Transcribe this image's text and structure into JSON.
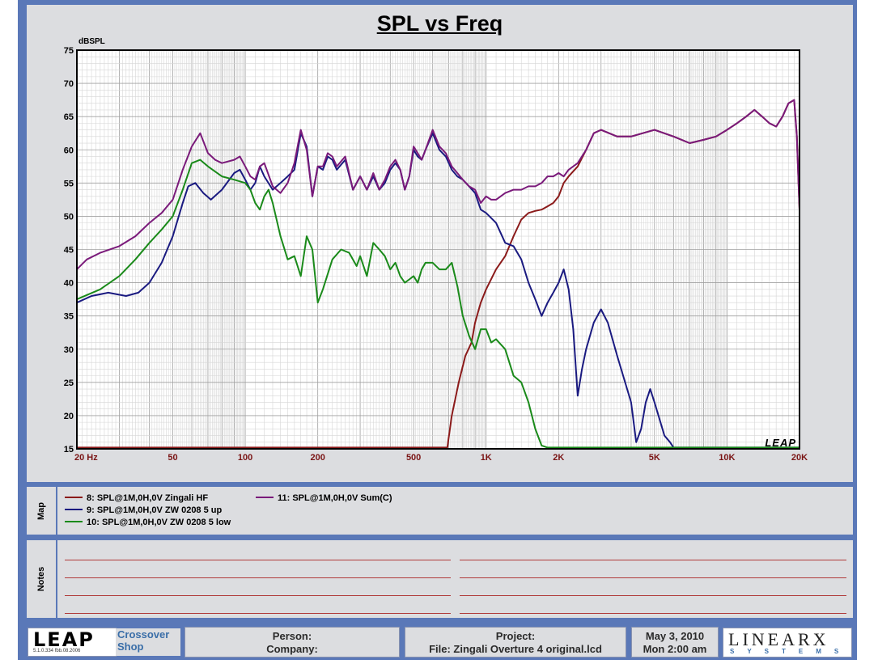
{
  "chart_data": {
    "type": "line",
    "title": "SPL vs Freq",
    "ylabel": "dBSPL",
    "xlabel": "",
    "xscale": "log",
    "xlim": [
      20,
      20000
    ],
    "ylim": [
      15,
      75
    ],
    "grid": true,
    "yticks": [
      "75",
      "70",
      "65",
      "60",
      "55",
      "50",
      "45",
      "40",
      "35",
      "30",
      "25",
      "20",
      "15"
    ],
    "xticks": [
      {
        "v": 20,
        "label": "20  Hz"
      },
      {
        "v": 50,
        "label": "50"
      },
      {
        "v": 100,
        "label": "100"
      },
      {
        "v": 200,
        "label": "200"
      },
      {
        "v": 500,
        "label": "500"
      },
      {
        "v": 1000,
        "label": "1K"
      },
      {
        "v": 2000,
        "label": "2K"
      },
      {
        "v": 5000,
        "label": "5K"
      },
      {
        "v": 10000,
        "label": "10K"
      },
      {
        "v": 20000,
        "label": "20K"
      }
    ],
    "series": [
      {
        "name": "8: SPL@1M,0H,0V Zingali HF",
        "color": "#8b1a1a",
        "points": [
          [
            20,
            15.2
          ],
          [
            600,
            15.2
          ],
          [
            690,
            15.2
          ],
          [
            720,
            20
          ],
          [
            770,
            25
          ],
          [
            820,
            29
          ],
          [
            870,
            31
          ],
          [
            900,
            34
          ],
          [
            950,
            37
          ],
          [
            1000,
            39
          ],
          [
            1100,
            42
          ],
          [
            1200,
            44
          ],
          [
            1300,
            47
          ],
          [
            1400,
            49.5
          ],
          [
            1500,
            50.5
          ],
          [
            1600,
            50.8
          ],
          [
            1700,
            51
          ],
          [
            1800,
            51.5
          ],
          [
            1900,
            52
          ],
          [
            2000,
            53
          ],
          [
            2100,
            55
          ],
          [
            2200,
            56
          ],
          [
            2400,
            57.5
          ],
          [
            2600,
            60
          ],
          [
            2800,
            62.5
          ],
          [
            3000,
            63
          ],
          [
            3500,
            62
          ],
          [
            4000,
            62
          ],
          [
            5000,
            63
          ],
          [
            6000,
            62
          ],
          [
            7000,
            61
          ],
          [
            8000,
            61.5
          ],
          [
            9000,
            62
          ],
          [
            10000,
            63
          ],
          [
            11000,
            64
          ],
          [
            12000,
            65
          ],
          [
            13000,
            66
          ],
          [
            14000,
            65
          ],
          [
            15000,
            64
          ],
          [
            16000,
            63.5
          ],
          [
            17000,
            65
          ],
          [
            18000,
            67
          ],
          [
            19000,
            67.5
          ],
          [
            19500,
            62
          ],
          [
            20000,
            51
          ]
        ]
      },
      {
        "name": "9: SPL@1M,0H,0V ZW 0208 5 up",
        "color": "#1a1a80",
        "points": [
          [
            20,
            37
          ],
          [
            23,
            38
          ],
          [
            27,
            38.5
          ],
          [
            32,
            38
          ],
          [
            36,
            38.5
          ],
          [
            40,
            40
          ],
          [
            45,
            43
          ],
          [
            50,
            47
          ],
          [
            55,
            52
          ],
          [
            58,
            54.5
          ],
          [
            62,
            55
          ],
          [
            67,
            53.5
          ],
          [
            72,
            52.5
          ],
          [
            80,
            54
          ],
          [
            90,
            56.5
          ],
          [
            95,
            57
          ],
          [
            100,
            55.5
          ],
          [
            105,
            54
          ],
          [
            110,
            55
          ],
          [
            115,
            57.5
          ],
          [
            120,
            56
          ],
          [
            130,
            54
          ],
          [
            140,
            55
          ],
          [
            150,
            56
          ],
          [
            160,
            57
          ],
          [
            170,
            62.5
          ],
          [
            180,
            60.5
          ],
          [
            190,
            53
          ],
          [
            200,
            57.5
          ],
          [
            210,
            57
          ],
          [
            220,
            59
          ],
          [
            230,
            58.5
          ],
          [
            240,
            57
          ],
          [
            260,
            58.5
          ],
          [
            280,
            54
          ],
          [
            300,
            56
          ],
          [
            320,
            54
          ],
          [
            340,
            56
          ],
          [
            360,
            54
          ],
          [
            380,
            55
          ],
          [
            400,
            57
          ],
          [
            420,
            58
          ],
          [
            440,
            57
          ],
          [
            460,
            54
          ],
          [
            480,
            56
          ],
          [
            500,
            60
          ],
          [
            520,
            59
          ],
          [
            540,
            58.5
          ],
          [
            560,
            60
          ],
          [
            600,
            62.5
          ],
          [
            640,
            60
          ],
          [
            680,
            59
          ],
          [
            720,
            57
          ],
          [
            760,
            56
          ],
          [
            800,
            55.5
          ],
          [
            850,
            54.5
          ],
          [
            900,
            53.5
          ],
          [
            950,
            51
          ],
          [
            1000,
            50.5
          ],
          [
            1100,
            49
          ],
          [
            1200,
            46
          ],
          [
            1300,
            45.5
          ],
          [
            1400,
            43.5
          ],
          [
            1500,
            40
          ],
          [
            1600,
            37.5
          ],
          [
            1700,
            35
          ],
          [
            1800,
            37
          ],
          [
            1900,
            38.5
          ],
          [
            2000,
            40
          ],
          [
            2100,
            42
          ],
          [
            2200,
            39
          ],
          [
            2300,
            33
          ],
          [
            2400,
            23
          ],
          [
            2500,
            27
          ],
          [
            2600,
            30
          ],
          [
            2800,
            34
          ],
          [
            3000,
            36
          ],
          [
            3200,
            34
          ],
          [
            3500,
            29
          ],
          [
            4000,
            22
          ],
          [
            4200,
            16
          ],
          [
            4400,
            18
          ],
          [
            4600,
            22
          ],
          [
            4800,
            24
          ],
          [
            5000,
            22
          ],
          [
            5500,
            17
          ],
          [
            5800,
            16
          ],
          [
            6000,
            15.2
          ],
          [
            20000,
            15.2
          ]
        ]
      },
      {
        "name": "10: SPL@1M,0H,0V ZW 0208 5 low",
        "color": "#1a8a1a",
        "points": [
          [
            20,
            37.5
          ],
          [
            25,
            39
          ],
          [
            30,
            41
          ],
          [
            35,
            43.5
          ],
          [
            40,
            46
          ],
          [
            45,
            48
          ],
          [
            50,
            50
          ],
          [
            55,
            54
          ],
          [
            60,
            58
          ],
          [
            65,
            58.5
          ],
          [
            70,
            57.5
          ],
          [
            80,
            56
          ],
          [
            90,
            55.5
          ],
          [
            100,
            55
          ],
          [
            105,
            54
          ],
          [
            110,
            52
          ],
          [
            115,
            51
          ],
          [
            120,
            53
          ],
          [
            125,
            54
          ],
          [
            130,
            52
          ],
          [
            140,
            47
          ],
          [
            150,
            43.5
          ],
          [
            160,
            44
          ],
          [
            170,
            41
          ],
          [
            180,
            47
          ],
          [
            190,
            45
          ],
          [
            200,
            37
          ],
          [
            210,
            39
          ],
          [
            230,
            43.5
          ],
          [
            250,
            45
          ],
          [
            270,
            44.5
          ],
          [
            290,
            42.5
          ],
          [
            300,
            44
          ],
          [
            320,
            41
          ],
          [
            340,
            46
          ],
          [
            360,
            45
          ],
          [
            380,
            44
          ],
          [
            400,
            42
          ],
          [
            420,
            43
          ],
          [
            440,
            41
          ],
          [
            460,
            40
          ],
          [
            480,
            40.5
          ],
          [
            500,
            41
          ],
          [
            520,
            40
          ],
          [
            540,
            42
          ],
          [
            560,
            43
          ],
          [
            600,
            43
          ],
          [
            640,
            42
          ],
          [
            680,
            42
          ],
          [
            720,
            43
          ],
          [
            760,
            39.5
          ],
          [
            800,
            35
          ],
          [
            850,
            32
          ],
          [
            900,
            30
          ],
          [
            950,
            33
          ],
          [
            1000,
            33
          ],
          [
            1050,
            31
          ],
          [
            1100,
            31.5
          ],
          [
            1200,
            30
          ],
          [
            1300,
            26
          ],
          [
            1400,
            25
          ],
          [
            1500,
            22
          ],
          [
            1600,
            18
          ],
          [
            1700,
            15.5
          ],
          [
            1800,
            15.2
          ],
          [
            20000,
            15.2
          ]
        ]
      },
      {
        "name": "11: SPL@1M,0H,0V Sum(C)",
        "color": "#7a1a7a",
        "points": [
          [
            20,
            42
          ],
          [
            22,
            43.5
          ],
          [
            25,
            44.5
          ],
          [
            30,
            45.5
          ],
          [
            35,
            47
          ],
          [
            40,
            49
          ],
          [
            45,
            50.5
          ],
          [
            50,
            52.5
          ],
          [
            55,
            57
          ],
          [
            60,
            60.5
          ],
          [
            65,
            62.5
          ],
          [
            70,
            59.5
          ],
          [
            75,
            58.5
          ],
          [
            80,
            58
          ],
          [
            90,
            58.5
          ],
          [
            95,
            59
          ],
          [
            100,
            57.5
          ],
          [
            105,
            56
          ],
          [
            110,
            55.5
          ],
          [
            115,
            57.5
          ],
          [
            120,
            58
          ],
          [
            130,
            54.5
          ],
          [
            140,
            53.5
          ],
          [
            150,
            55
          ],
          [
            160,
            58
          ],
          [
            170,
            63
          ],
          [
            180,
            60
          ],
          [
            190,
            53
          ],
          [
            200,
            57.5
          ],
          [
            210,
            57.5
          ],
          [
            220,
            59.5
          ],
          [
            230,
            59
          ],
          [
            240,
            57.5
          ],
          [
            260,
            59
          ],
          [
            280,
            54
          ],
          [
            300,
            56
          ],
          [
            320,
            54
          ],
          [
            340,
            56.5
          ],
          [
            360,
            54
          ],
          [
            380,
            55.5
          ],
          [
            400,
            57.5
          ],
          [
            420,
            58.5
          ],
          [
            440,
            57
          ],
          [
            460,
            54
          ],
          [
            480,
            56
          ],
          [
            500,
            60.5
          ],
          [
            520,
            59.5
          ],
          [
            540,
            58.5
          ],
          [
            560,
            60
          ],
          [
            600,
            63
          ],
          [
            640,
            60.5
          ],
          [
            680,
            59.5
          ],
          [
            720,
            57.5
          ],
          [
            760,
            56.5
          ],
          [
            800,
            55.5
          ],
          [
            850,
            54.5
          ],
          [
            900,
            54
          ],
          [
            950,
            52
          ],
          [
            1000,
            53
          ],
          [
            1050,
            52.5
          ],
          [
            1100,
            52.5
          ],
          [
            1200,
            53.5
          ],
          [
            1300,
            54
          ],
          [
            1400,
            54
          ],
          [
            1500,
            54.5
          ],
          [
            1600,
            54.5
          ],
          [
            1700,
            55
          ],
          [
            1800,
            56
          ],
          [
            1900,
            56
          ],
          [
            2000,
            56.5
          ],
          [
            2100,
            56
          ],
          [
            2200,
            57
          ],
          [
            2400,
            58
          ],
          [
            2600,
            60
          ],
          [
            2800,
            62.5
          ],
          [
            3000,
            63
          ],
          [
            3500,
            62
          ],
          [
            4000,
            62
          ],
          [
            5000,
            63
          ],
          [
            6000,
            62
          ],
          [
            7000,
            61
          ],
          [
            8000,
            61.5
          ],
          [
            9000,
            62
          ],
          [
            10000,
            63
          ],
          [
            11000,
            64
          ],
          [
            12000,
            65
          ],
          [
            13000,
            66
          ],
          [
            14000,
            65
          ],
          [
            15000,
            64
          ],
          [
            16000,
            63.5
          ],
          [
            17000,
            65
          ],
          [
            18000,
            67
          ],
          [
            19000,
            67.5
          ],
          [
            19500,
            62
          ],
          [
            20000,
            51
          ]
        ]
      }
    ]
  },
  "map": {
    "label": "Map",
    "items": [
      {
        "text": "8: SPL@1M,0H,0V Zingali HF",
        "color": "#8b1a1a"
      },
      {
        "text": "9: SPL@1M,0H,0V ZW 0208 5 up",
        "color": "#1a1a80"
      },
      {
        "text": "10: SPL@1M,0H,0V ZW 0208 5 low",
        "color": "#1a8a1a"
      },
      {
        "text": "11: SPL@1M,0H,0V Sum(C)",
        "color": "#7a1a7a"
      }
    ]
  },
  "notes": {
    "label": "Notes"
  },
  "watermark": "LEAP",
  "footer": {
    "logo_text": "LEAP",
    "logo_sub": "5.1.0.334  fbb.08.2006",
    "module_line1": "Crossover",
    "module_line2": "Shop",
    "person_label": "Person:",
    "company_label": "Company:",
    "project_label": "Project:",
    "file_label": "File: Zingali Overture 4 original.lcd",
    "date": "May  3, 2010",
    "time": "Mon  2:00 am",
    "brand": "LINEARX",
    "brand_sub": "SYSTEMS"
  },
  "colors": {
    "frame": "#5a78b8",
    "panel": "#dcdde0",
    "grid": "#b8b8b8",
    "axis_x_labels": "#7a1414"
  }
}
